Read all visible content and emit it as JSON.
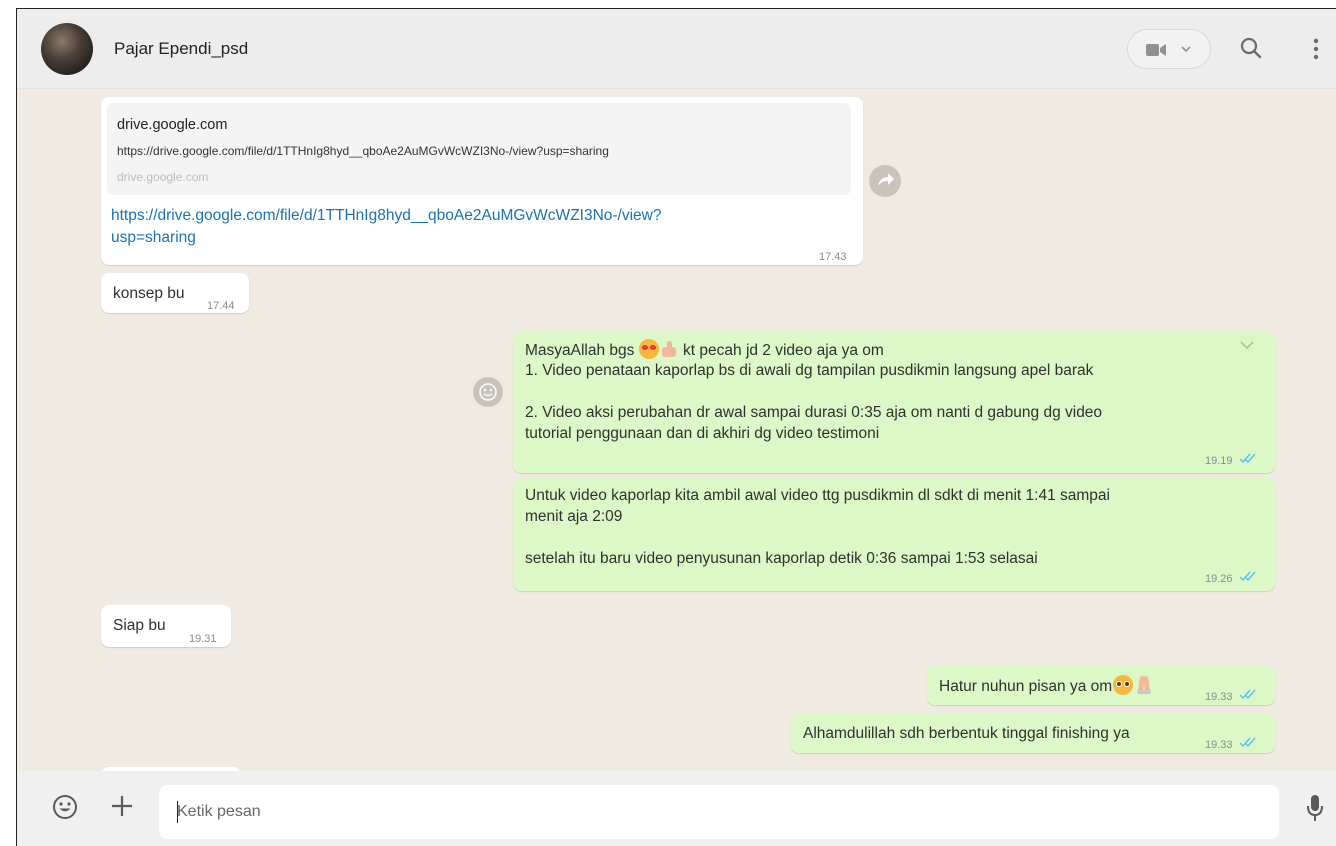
{
  "header": {
    "contact_name": "Pajar Ependi_psd",
    "icons": [
      "avatar",
      "video-call-icon",
      "chevron-down-icon",
      "search-icon",
      "menu-icon"
    ]
  },
  "messages": {
    "link_msg": {
      "preview_title": "drive.google.com",
      "preview_desc": "https://drive.google.com/file/d/1TTHnIg8hyd__qboAe2AuMGvWcWZI3No-/view?usp=sharing",
      "preview_domain": "drive.google.com",
      "link_line1": "https://drive.google.com/file/d/1TTHnIg8hyd__qboAe2AuMGvWcWZI3No-/view?",
      "link_line2": "usp=sharing",
      "time": "17.43"
    },
    "konsep": {
      "text": "konsep bu",
      "time": "17.44"
    },
    "masya": {
      "line1_a": "MasyaAllah bgs ",
      "line1_b": " kt pecah jd 2 video aja ya om",
      "line2": "1. Video penataan kaporlap bs di awali dg tampilan pusdikmin langsung apel barak",
      "line3": "2. Video aksi perubahan dr awal sampai durasi 0:35 aja om nanti d gabung dg video",
      "line4": "tutorial penggunaan dan di akhiri dg video testimoni",
      "time": "19.19"
    },
    "untuk": {
      "line1": "Untuk video kaporlap kita ambil awal video ttg pusdikmin dl sdkt di menit 1:41 sampai",
      "line2": "menit aja 2:09",
      "line3": "setelah itu baru video penyusunan kaporlap detik 0:36 sampai 1:53 selasai",
      "time": "19.26"
    },
    "siap": {
      "text": "Siap bu",
      "time": "19.31"
    },
    "hatur": {
      "text": "Hatur nuhun pisan ya om",
      "time": "19.33"
    },
    "alham": {
      "text": "Alhamdulillah sdh berbentuk tinggal finishing ya",
      "time": "19.33"
    }
  },
  "footer": {
    "placeholder": "Ketik pesan"
  },
  "colors": {
    "chat_bg": "#efeae2",
    "incoming": "#ffffff",
    "outgoing": "#dcf8c6",
    "link": "#1a73b8",
    "read_ticks": "#4fc3f7"
  }
}
